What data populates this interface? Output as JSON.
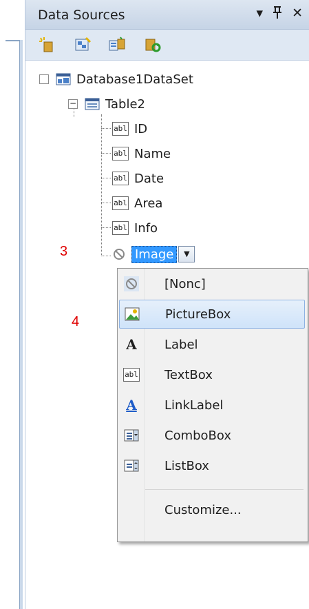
{
  "panel": {
    "title": "Data Sources",
    "title_icons": [
      "▾",
      "ᵖ",
      "✕"
    ]
  },
  "toolbar": {
    "tools": [
      "add-data-source-icon",
      "edit-dataset-designer-icon",
      "configure-dataset-icon",
      "refresh-icon"
    ]
  },
  "tree": {
    "dataset": "Database1DataSet",
    "table": "Table2",
    "fields": [
      "ID",
      "Name",
      "Date",
      "Area",
      "Info"
    ],
    "selected_field": "Image",
    "field_icon": "abl"
  },
  "annotations": {
    "step3": "3",
    "step4": "4"
  },
  "dropdown": {
    "items": [
      {
        "label": "[Nonc]",
        "icon": "none-icon"
      },
      {
        "label": "PictureBox",
        "icon": "picturebox-icon"
      },
      {
        "label": "Label",
        "icon": "label-icon"
      },
      {
        "label": "TextBox",
        "icon": "textbox-icon"
      },
      {
        "label": "LinkLabel",
        "icon": "linklabel-icon"
      },
      {
        "label": "ComboBox",
        "icon": "combobox-icon"
      },
      {
        "label": "ListBox",
        "icon": "listbox-icon"
      }
    ],
    "customize": "Customize...",
    "highlighted": "PictureBox"
  },
  "colors": {
    "selection": "#3399ff",
    "annotation": "#e00000"
  }
}
